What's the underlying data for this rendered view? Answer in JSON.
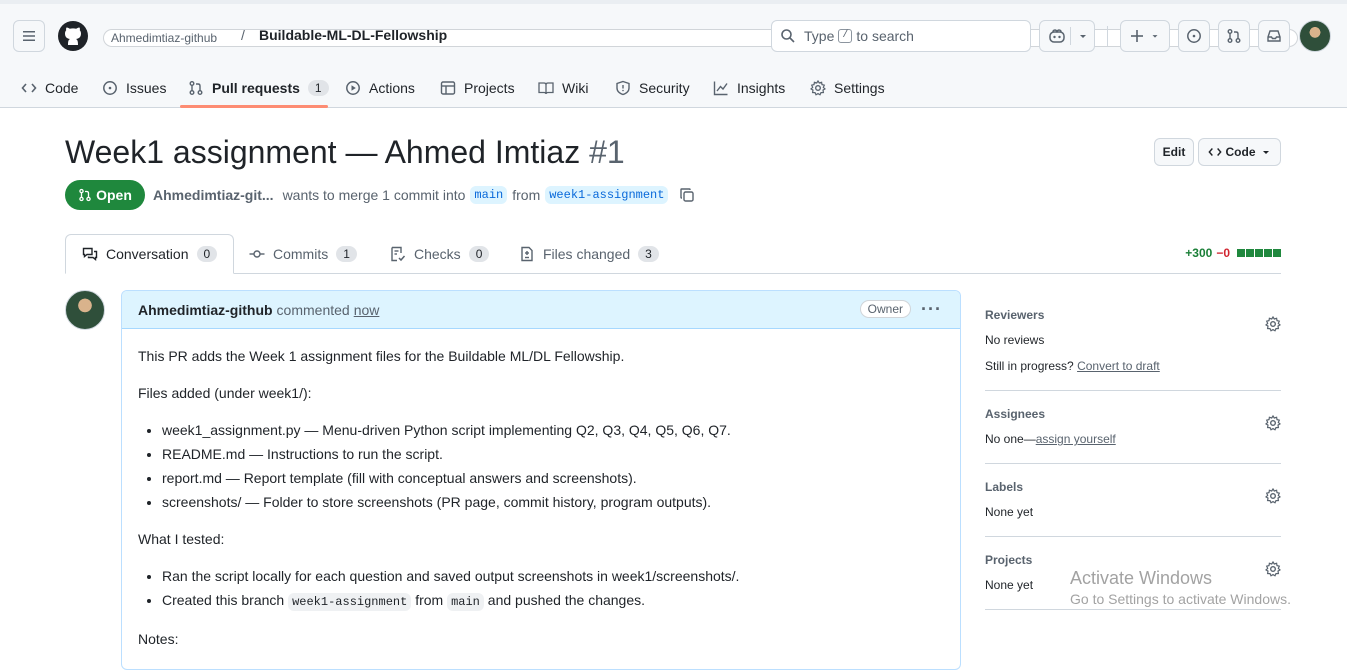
{
  "header": {
    "owner": "Ahmedimtiaz-github",
    "separator": "/",
    "repo": "Buildable-ML-DL-Fellowship",
    "search_pre": "Type",
    "search_key": "/",
    "search_post": "to search"
  },
  "repo_tabs": [
    {
      "label": "Code"
    },
    {
      "label": "Issues"
    },
    {
      "label": "Pull requests",
      "count": "1"
    },
    {
      "label": "Actions"
    },
    {
      "label": "Projects"
    },
    {
      "label": "Wiki"
    },
    {
      "label": "Security"
    },
    {
      "label": "Insights"
    },
    {
      "label": "Settings"
    }
  ],
  "pr": {
    "title": "Week1 assignment — Ahmed Imtiaz",
    "number": "#1",
    "edit_label": "Edit",
    "code_label": "Code",
    "state": "Open",
    "author": "Ahmedimtiaz-git...",
    "merge_text": "wants to merge 1 commit into",
    "base": "main",
    "from_text": "from",
    "head": "week1-assignment"
  },
  "pr_tabs": [
    {
      "label": "Conversation",
      "count": "0"
    },
    {
      "label": "Commits",
      "count": "1"
    },
    {
      "label": "Checks",
      "count": "0"
    },
    {
      "label": "Files changed",
      "count": "3"
    }
  ],
  "diffstat": {
    "additions": "+300",
    "deletions": "−0"
  },
  "comment": {
    "author": "Ahmedimtiaz-github",
    "action": "commented",
    "time": "now",
    "badge": "Owner",
    "intro": "This PR adds the Week 1 assignment files for the Buildable ML/DL Fellowship.",
    "files_heading": "Files added (under week1/):",
    "files": [
      "week1_assignment.py — Menu-driven Python script implementing Q2, Q3, Q4, Q5, Q6, Q7.",
      "README.md — Instructions to run the script.",
      "report.md — Report template (fill with conceptual answers and screenshots).",
      "screenshots/ — Folder to store screenshots (PR page, commit history, program outputs)."
    ],
    "tested_heading": "What I tested:",
    "tested_1": "Ran the script locally for each question and saved output screenshots in week1/screenshots/.",
    "tested_2_pre": "Created this branch",
    "tested_2_code1": "week1-assignment",
    "tested_2_mid": "from",
    "tested_2_code2": "main",
    "tested_2_post": "and pushed the changes.",
    "notes_heading": "Notes:"
  },
  "sidebar": {
    "reviewers_title": "Reviewers",
    "reviewers_value": "No reviews",
    "progress_pre": "Still in progress?",
    "progress_link": "Convert to draft",
    "assignees_title": "Assignees",
    "assignees_pre": "No one—",
    "assignees_link": "assign yourself",
    "labels_title": "Labels",
    "labels_value": "None yet",
    "projects_title": "Projects",
    "projects_value": "None yet"
  },
  "watermark": {
    "line1": "Activate Windows",
    "line2": "Go to Settings to activate Windows."
  },
  "colors": {
    "accent": "#0969da",
    "open_green": "#1f883d",
    "tab_underline": "#fd8c73"
  }
}
